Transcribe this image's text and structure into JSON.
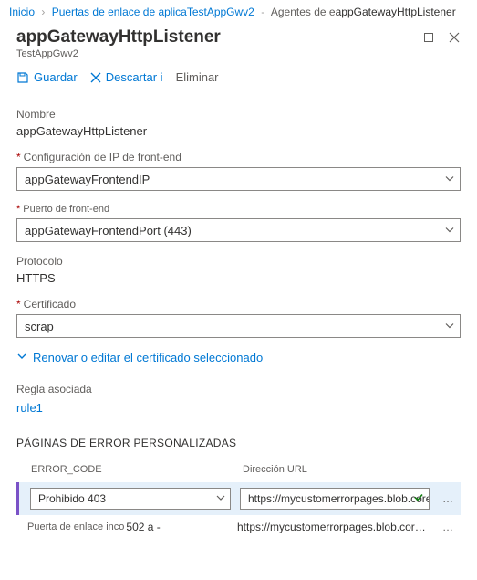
{
  "breadcrumb": {
    "home": "Inicio",
    "seg1": "Puertas de enlace de aplica",
    "seg2": "TestAppGwv2",
    "seg3": "Agentes de e",
    "current": "appGatewayHttpListener"
  },
  "header": {
    "title": "appGatewayHttpListener",
    "subtitle": "TestAppGwv2"
  },
  "toolbar": {
    "save": "Guardar",
    "discard": "Descartar i",
    "delete": "Eliminar"
  },
  "form": {
    "name_label": "Nombre",
    "name_value": "appGatewayHttpListener",
    "frontend_ip_label": "Configuración de IP de front-end",
    "frontend_ip_value": "appGatewayFrontendIP",
    "frontend_port_label": "Puerto de front-end",
    "frontend_port_value": "appGatewayFrontendPort (443)",
    "protocol_label": "Protocolo",
    "protocol_value": "HTTPS",
    "certificate_label": "Certificado",
    "certificate_value": "scrap",
    "renew_link": "Renovar o editar el certificado seleccionado",
    "rule_label": "Regla asociada",
    "rule_value": "rule1"
  },
  "custom_errors": {
    "section": "PÁGINAS DE ERROR PERSONALIZADAS",
    "col_code": "ERROR_CODE",
    "col_url": "Dirección URL",
    "rows": [
      {
        "code_label": "Prohibido",
        "code_value": "403",
        "url": "https://mycustomerrorpages.blob.core.w"
      },
      {
        "code_label": "Puerta de enlace inco",
        "code_value": "502 a -",
        "url": "https://mycustomerrorpages.blob.core.wind"
      }
    ]
  }
}
